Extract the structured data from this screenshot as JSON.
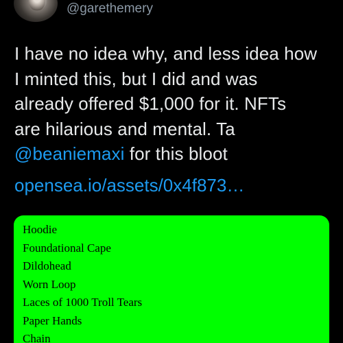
{
  "author": {
    "handle": "@garethemery",
    "avatar_icon": "profile-photo"
  },
  "tweet": {
    "lines": [
      "I have no idea why, and less idea how",
      "I minted this, but I did and was",
      "already offered $1,000 for it. NFTs",
      "are hilarious and mental. Ta"
    ],
    "mention": "@beaniemaxi",
    "mention_suffix": " for this bloot",
    "link": "opensea.io/assets/0x4f873…"
  },
  "card": {
    "background": "#00ff00",
    "items": [
      "Hoodie",
      "Foundational Cape",
      "Dildohead",
      "Worn Loop",
      "Laces of 1000 Troll Tears",
      "Paper Hands",
      "Chain"
    ]
  },
  "colors": {
    "background": "#000000",
    "text": "#e7e9ea",
    "secondary_text": "#8b98a5",
    "link": "#1d9bf0"
  }
}
